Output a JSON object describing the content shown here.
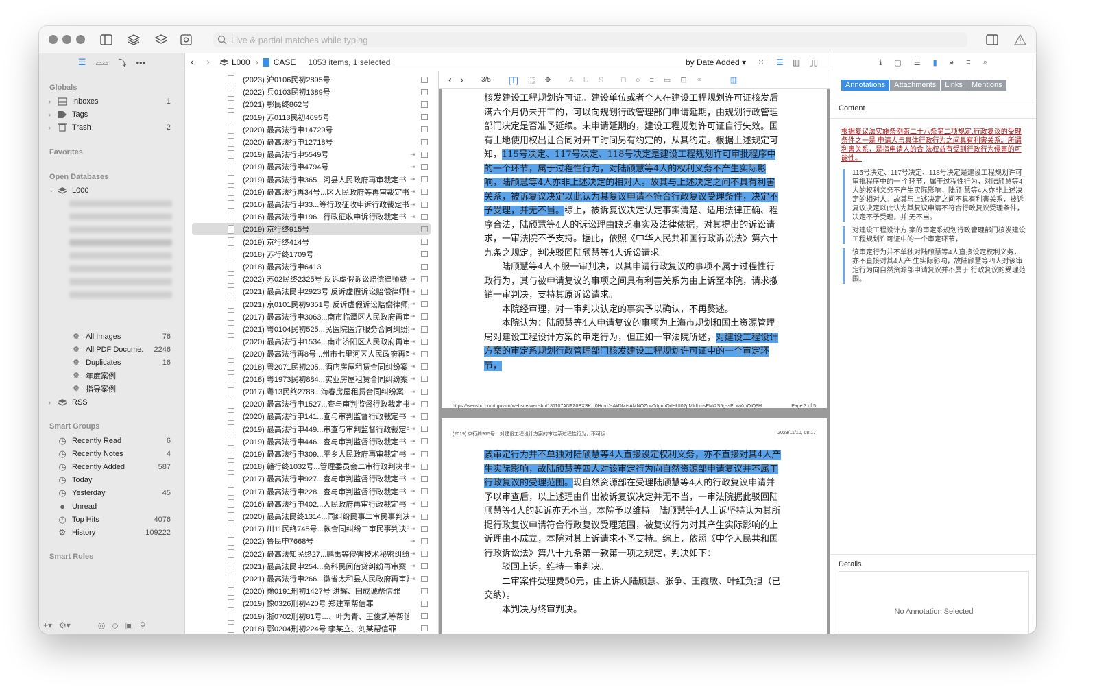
{
  "toolbar": {
    "search_placeholder": "Live & partial matches while typing"
  },
  "sidebar": {
    "globals_title": "Globals",
    "globals": [
      {
        "label": "Inboxes",
        "count": "1"
      },
      {
        "label": "Tags",
        "count": ""
      },
      {
        "label": "Trash",
        "count": "2"
      }
    ],
    "favorites_title": "Favorites",
    "open_db_title": "Open Databases",
    "database": "L000",
    "db_items": [
      {
        "label": "All Images",
        "count": "76"
      },
      {
        "label": "All PDF Docume...",
        "count": "2246"
      },
      {
        "label": "Duplicates",
        "count": "16"
      },
      {
        "label": "年度案例",
        "count": ""
      },
      {
        "label": "指导案例",
        "count": ""
      }
    ],
    "rss": "RSS",
    "smart_groups_title": "Smart Groups",
    "smart_groups": [
      {
        "label": "Recently Read",
        "count": "6"
      },
      {
        "label": "Recently Notes",
        "count": "4"
      },
      {
        "label": "Recently Added",
        "count": "587"
      },
      {
        "label": "Today",
        "count": ""
      },
      {
        "label": "Yesterday",
        "count": "45"
      },
      {
        "label": "Unread",
        "count": ""
      },
      {
        "label": "Top Hits",
        "count": "4076"
      },
      {
        "label": "History",
        "count": "109222"
      }
    ],
    "smart_rules_title": "Smart Rules"
  },
  "pathbar": {
    "db": "L000",
    "group": "CASE",
    "status": "1053 items, 1 selected",
    "sort": "by Date Added"
  },
  "list": [
    "(2023) 沪0106民初2895号",
    "(2022) 兵0103民初1389号",
    "(2021) 鄂民终862号",
    "(2019) 苏0113民初4695号",
    "(2020) 最高法行申14729号",
    "(2020) 最高法行申12718号",
    "(2019) 最高法行申5549号",
    "(2019) 最高法行申4794号",
    "(2019) 最高法行申365...河县人民政府再审裁定书",
    "(2019) 最高法行再34号...区人民政府等再审裁定书",
    "(2016) 最高法行申33...等行政征收申诉行政裁定书",
    "(2016) 最高法行申196...行政征收申诉行政裁定书",
    "(2019) 京行终915号",
    "(2019) 京行终414号",
    "(2018) 苏行终1709号",
    "(2018) 最高法行申6413",
    "(2022) 苏02民终2325号 反诉虚假诉讼赔偿律师费",
    "(2021) 最高法民申2923号 反诉虚假诉讼赔偿律师费",
    "(2021) 京0101民初9351号 反诉虚假诉讼赔偿律师费",
    "(2017) 最高法行申3063...南市临潭区人民政府再审案",
    "(2021) 粤0104民初525...民医院医疗服务合同纠纷案",
    "(2020) 最高法行申1534...南市济阳区人民政府再审案",
    "(2020) 最高法行再8号...州市七里河区人民政府再审案",
    "(2018) 粤2071民初205...酒店房屋租赁合同纠纷案",
    "(2018) 粤1973民初884...实业房屋租赁合同纠纷案",
    "(2017) 粤13民终2788...海春房屋租赁合同纠纷案",
    "(2020) 最高法行申1527...查与审判监督行政裁定书",
    "(2020) 最高法行申141...查与审判监督行政裁定书",
    "(2019) 最高法行申449...审查与审判监督行政裁定书",
    "(2019) 最高法行申446...查与审判监督行政裁定书",
    "(2019) 最高法行申309...平乡人民政府再审裁定书",
    "(2018) 赣行终1032号...管理委员会二审行政判决书",
    "(2017) 最高法行申927...查与审判监督行政裁定书",
    "(2017) 最高法行申228...查与审判监督行政裁定书",
    "(2016) 最高法行申402...人民政府再审行政裁定书",
    "(2020) 最高法民终1314...同纠纷民事二审民事判决书",
    "(2017) 川11民终745号...款合同纠纷二审民事判决书",
    "(2022) 鲁民申7668号",
    "(2022) 最高法知民终27...鹏禹等侵害技术秘密纠纷案",
    "(2021) 最高法民申254...高科民间借贷纠纷再审案",
    "(2021) 最高法行申266...徽省太和县人民政府再审案",
    "(2020) 豫0191刑初1427号 洪辉、田成诚帮信罪",
    "(2019) 豫0326刑初420号 郑建军帮信罪",
    "(2019) 浙0702刑初81号...、叶为青、王俊凯等帮信罪",
    "(2018) 鄂0204刑初224号 李某立、刘某帮信罪"
  ],
  "doc_toolbar": {
    "page_indicator": "3/5"
  },
  "page1": {
    "p1_a": "核发建设工程规划许可证。建设单位或者个人在建设工程规划许可证核发后满六个月仍未开工的，可以向规划行政管理部门申请延期，由规划行政管理部门决定是否准予延续。未申请延期的，建设工程规划许可证自行失效。国有土地使用权出让合同对开工时间另有约定的，从其约定。根据上述规定可知，",
    "p1_hl": "115号决定、117号决定、118号决定是建设工程规划许可审批程序中的一个环节，属于过程性行为，对陆颀慧等4人的权利义务不产生实际影响，陆颀慧等4人亦非上述决定的相对人。故其与上述决定之间不具有利害关系，被诉复议决定以此认为其复议申请不符合行政复议受理条件，决定不予受理，并无不当。",
    "p1_b": "综上，被诉复议决定认定事实清楚、适用法律正确、程序合法，陆颀慧等4人的诉讼理由缺乏事实及法律依据，对其提出的诉讼请求，一审法院不予支持。据此，依照《中华人民共和国行政诉讼法》第六十九条之规定，判决驳回陆颀慧等4人诉讼请求。",
    "p2": "陆颀慧等4人不服一审判决，以其申请行政复议的事项不属于过程性行政行为，其与被申请复议的事项之间具有利害关系为由上诉至本院，请求撤销一审判决，支持其原诉讼请求。",
    "p3": "本院经审理，对一审判决认定的事实予以确认，不再赘述。",
    "p4_a": "本院认为：陆颀慧等4人申请复议的事项为上海市规划和国土资源管理局对建设工程设计方案的审定行为，但正如一审法院所述，",
    "p4_hl": "对建设工程设计方案的审定系规划行政管理部门核发建设工程规划许可证中的一个审定环节，",
    "footer_url": "https://wenshu.court.gov.cn/website/wenshu/181107ANFZ0BXSK...0HmuJsAkDM/sAMNOZcw0dgnnQdHUI02pMfdLmsEM/2S5gssPLwXruOlQ9H",
    "footer_page": "Page 3 of 5"
  },
  "page2": {
    "header_left": "(2019) 京行终915号：对建设工程设计方案的审定系过程性行为，不可诉",
    "header_right": "2023/11/10, 08:17",
    "p1_hl": "该审定行为并不单独对陆颀慧等4人直接设定权利义务，亦不直接对其4人产生实际影响，故陆颀慧等四人对该审定行为向自然资源部申请复议并不属于行政复议的受理范围。",
    "p1_b": "现自然资源部在受理陆颀慧等4人的行政复议申请并予以审查后，以上述理由作出被诉复议决定并无不当，一审法院据此驳回陆颀慧等4人的起诉亦无不当，本院予以维持。陆颀慧等4人上诉坚持认为其所提行政复议申请符合行政复议受理范围，被复议行为对其产生实际影响的上诉理由不成立，本院对其上诉请求不予支持。综上，依照《中华人民共和国行政诉讼法》第八十九条第一款第一项之规定，判决如下：",
    "p2": "驳回上诉，维持一审判决。",
    "p3": "二审案件受理费50元，由上诉人陆颀慧、张争、王霞敏、叶红负担（已交纳）。",
    "p4": "本判决为终审判决。"
  },
  "inspector": {
    "tabs": [
      "Annotations",
      "Attachments",
      "Links",
      "Mentions"
    ],
    "content_title": "Content",
    "underline_note": "根据复议法实施条例第二十八条第二项规定,行政复议的受理条件之一是 申请人与具体行政行为之间具有利害关系。所谓利害关系，是指申请人的合 法权益有受到行政行为侵害的可能性。",
    "annotations": [
      "115号决定、117号决定、118号决定是建设工程规划许可审批程序中的一 个环节，属于过程性行为，对陆颀慧等4人的权利义务不产生实际影响，陆颀 慧等4人亦非上述决定的相对人。故其与上述决定之间不具有利害关系，被诉 复议决定以此认为其复议申请不符合行政复议受理条件，决定不予受理，并 无不当。",
      "对建设工程设计方 案的审定系规划行政管理部门核发建设工程规划许可证中的一个审定环节，",
      "该审定行为并不单独对陆颀慧等4人直接设定权利义务，亦不直接对其4人产 生实际影响，故陆颀慧等四人对该审定行为向自然资源部申请复议并不属于 行政复议的受理范围。"
    ],
    "details_title": "Details",
    "details_empty": "No Annotation Selected"
  }
}
